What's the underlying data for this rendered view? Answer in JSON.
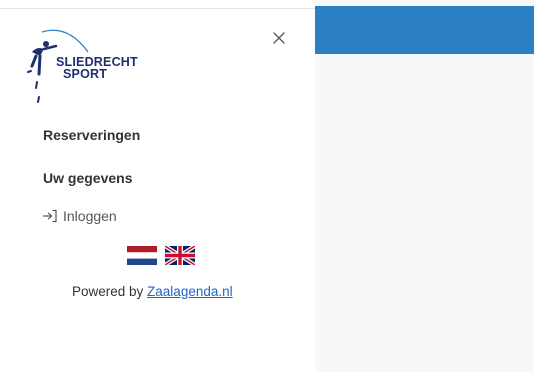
{
  "brand": {
    "line1": "SLIEDRECHT",
    "line2": "SPORT",
    "colors": {
      "navy": "#1f2f6e",
      "blue": "#2a80c2"
    }
  },
  "sidebar": {
    "close_icon": "close-icon",
    "items": [
      {
        "label": "Reserveringen"
      },
      {
        "label": "Uw gegevens"
      }
    ],
    "login": {
      "icon": "login-arrow-icon",
      "label": "Inloggen"
    },
    "languages": [
      {
        "icon": "flag-nl-icon"
      },
      {
        "icon": "flag-uk-icon"
      }
    ],
    "powered_by": {
      "prefix": "Powered by ",
      "link_text": "Zaalagenda.nl"
    }
  },
  "main": {
    "header_color": "#2a80c2"
  }
}
